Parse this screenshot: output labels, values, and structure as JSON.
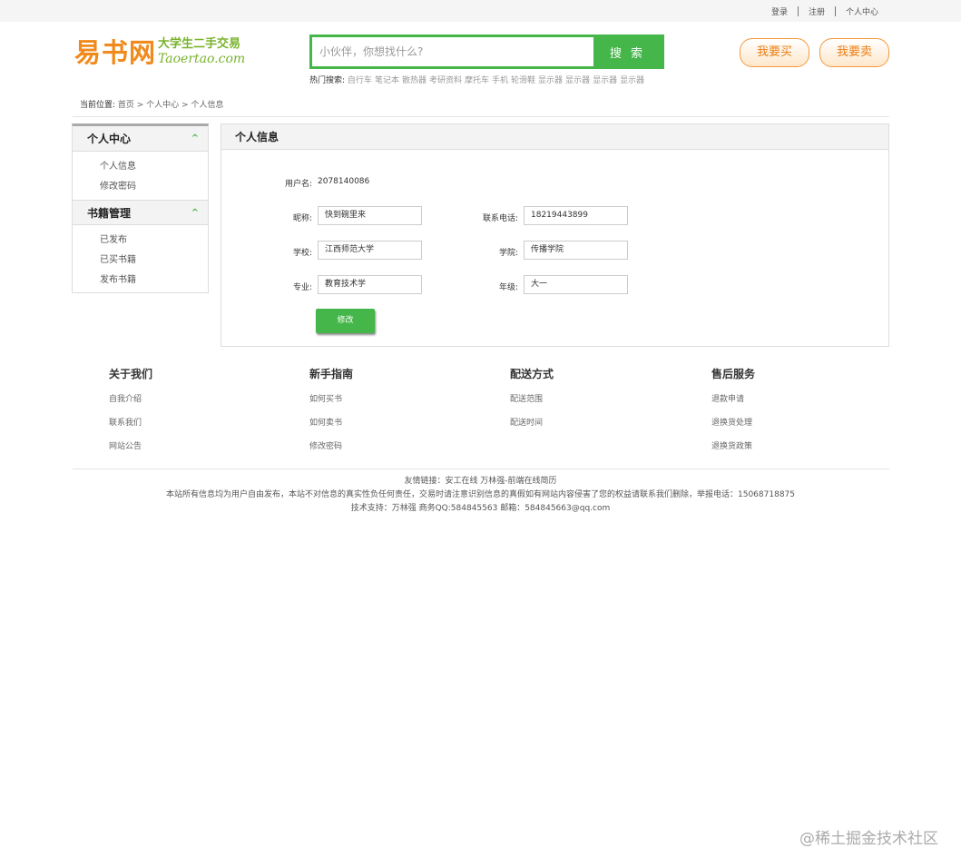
{
  "topbar": {
    "login": "登录",
    "register": "注册",
    "account": "个人中心"
  },
  "logo": {
    "cn": "易书网",
    "slogan": "大学生二手交易",
    "en": "Taoertao.com"
  },
  "search": {
    "placeholder": "小伙伴，你想找什么?",
    "button": "搜 索"
  },
  "hot": {
    "label": "热门搜索:",
    "keywords": [
      "自行车",
      "笔记本",
      "散热器",
      "考研资料",
      "摩托车",
      "手机",
      "轮滑鞋",
      "显示器",
      "显示器",
      "显示器",
      "显示器"
    ]
  },
  "header_buttons": {
    "buy": "我要买",
    "sell": "我要卖"
  },
  "breadcrumb": {
    "label": "当前位置:",
    "path": "首页 > 个人中心 > 个人信息"
  },
  "sidebar": {
    "section1": {
      "title": "个人中心",
      "items": [
        "个人信息",
        "修改密码"
      ]
    },
    "section2": {
      "title": "书籍管理",
      "items": [
        "已发布",
        "已买书籍",
        "发布书籍"
      ]
    }
  },
  "profile": {
    "title": "个人信息",
    "username_label": "用户名:",
    "username": "2078140086",
    "nickname_label": "昵称:",
    "nickname": "快到碗里来",
    "phone_label": "联系电话:",
    "phone": "18219443899",
    "school_label": "学校:",
    "school": "江西师范大学",
    "college_label": "学院:",
    "college": "传播学院",
    "major_label": "专业:",
    "major": "教育技术学",
    "grade_label": "年级:",
    "grade": "大一",
    "save": "修改"
  },
  "footer": {
    "columns": [
      {
        "title": "关于我们",
        "items": [
          "自我介绍",
          "联系我们",
          "网站公告"
        ]
      },
      {
        "title": "新手指南",
        "items": [
          "如何买书",
          "如何卖书",
          "修改密码"
        ]
      },
      {
        "title": "配送方式",
        "items": [
          "配送范围",
          "配送时间"
        ]
      },
      {
        "title": "售后服务",
        "items": [
          "退款申请",
          "退换货处理",
          "退换货政策"
        ]
      }
    ],
    "links": "友情链接：安工在线   万林强-前端在线简历",
    "disclaimer": "本站所有信息均为用户自由发布，本站不对信息的真实性负任何责任，交易时请注意识别信息的真假如有网站内容侵害了您的权益请联系我们删除，举报电话：15068718875",
    "support": "技术支持：万林强   商务QQ:584845563   邮箱：584845663@qq.com"
  },
  "watermark": "@稀土掘金技术社区"
}
